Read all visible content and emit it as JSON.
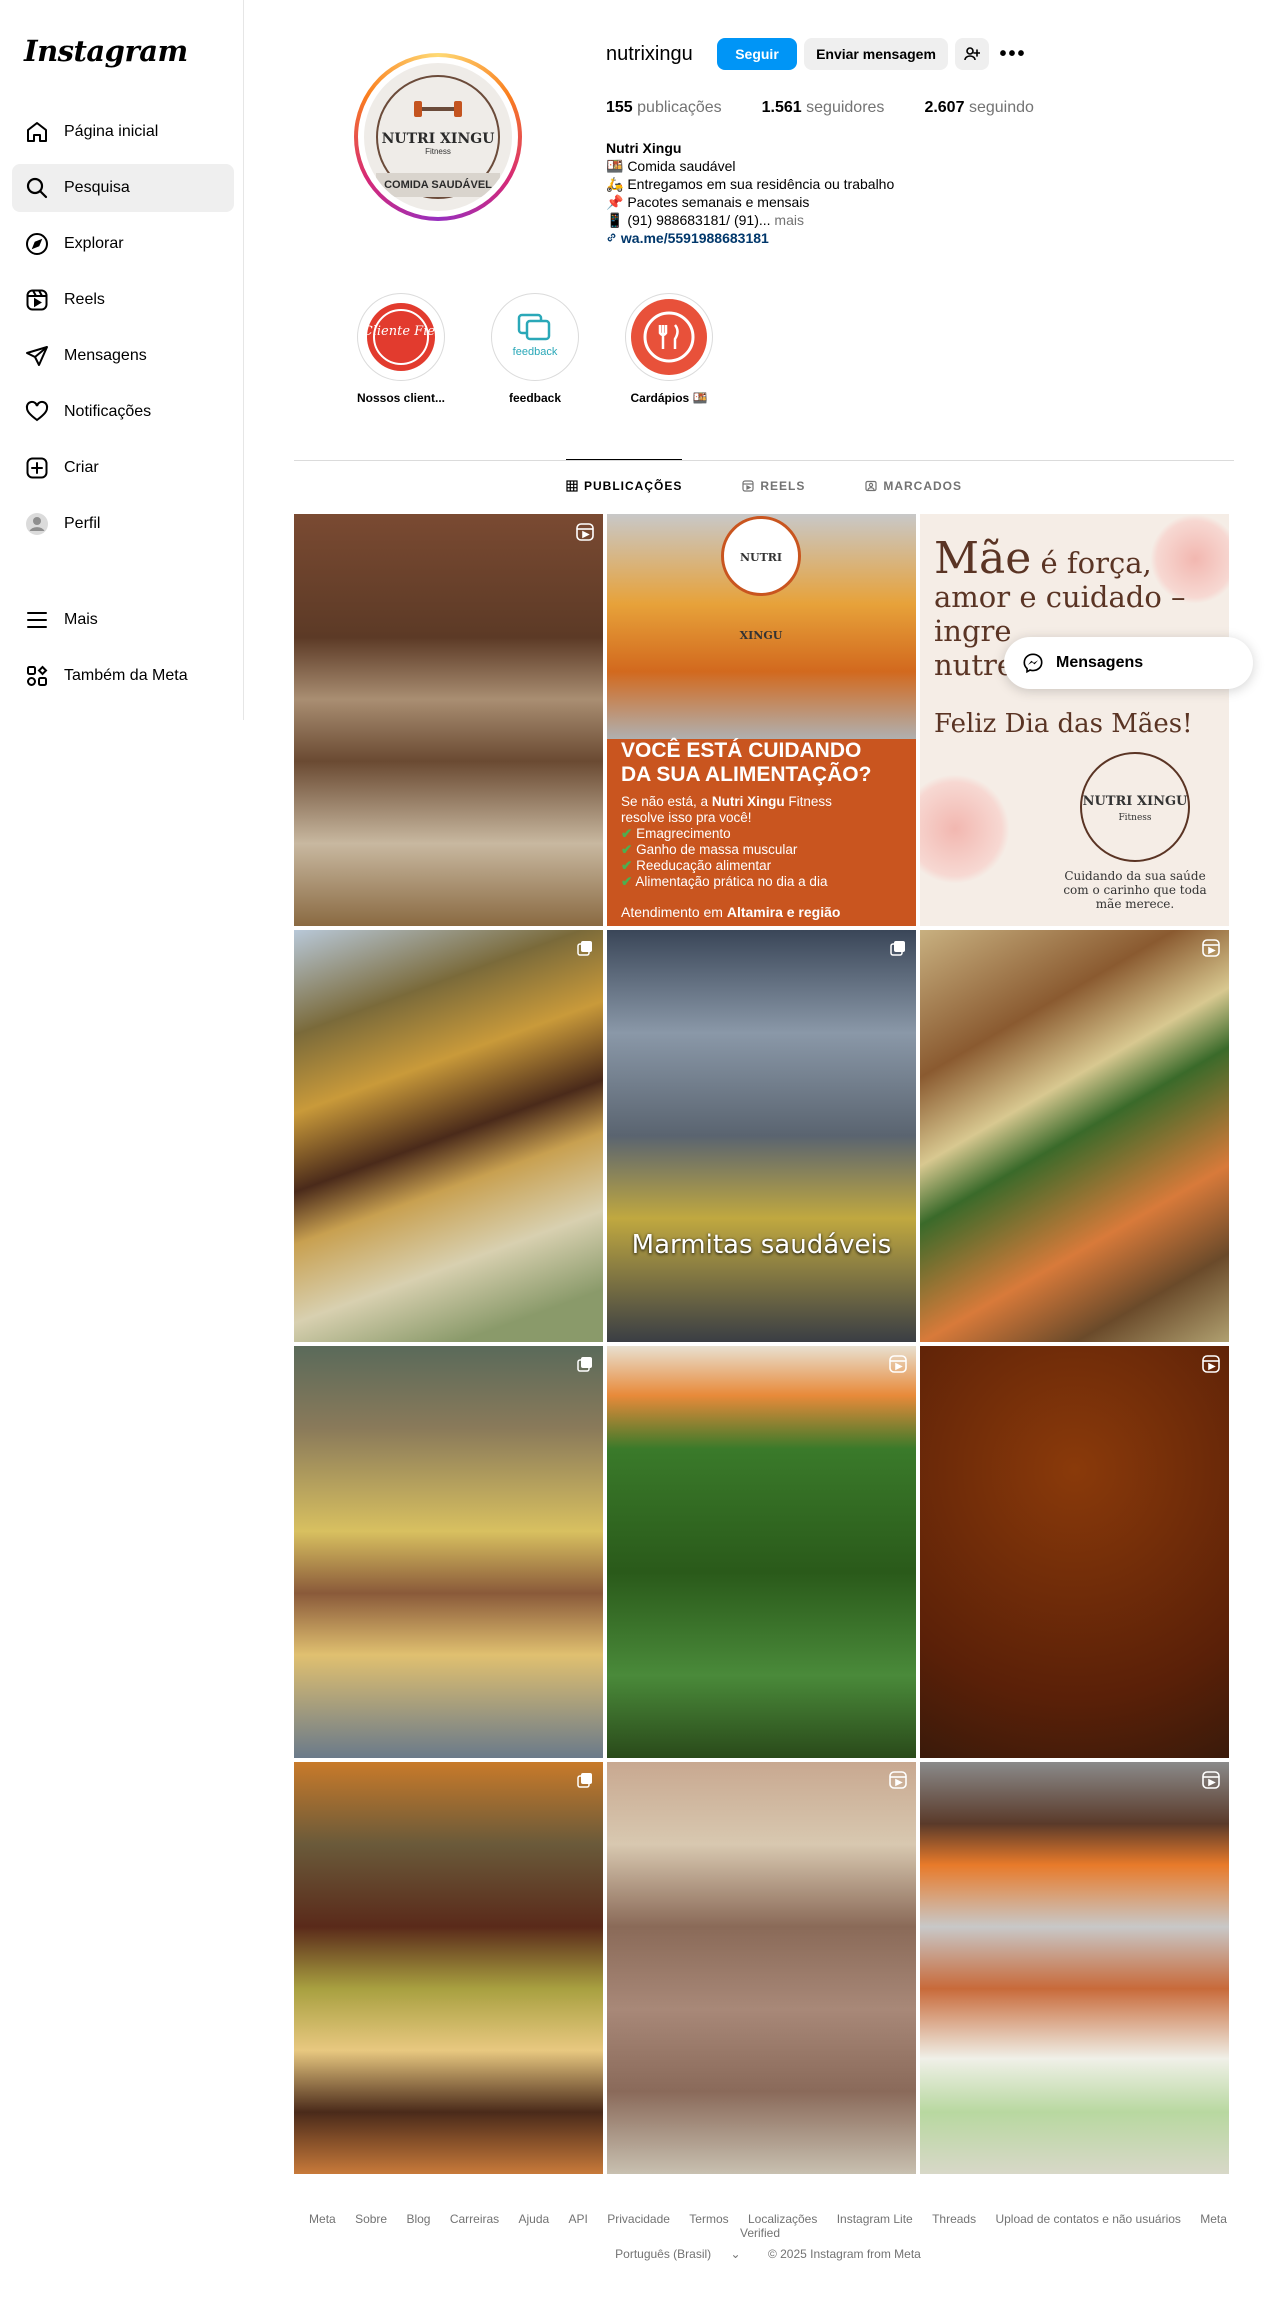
{
  "app": {
    "logo": "Instagram"
  },
  "sidebar": {
    "items": [
      {
        "label": "Página inicial",
        "icon": "home-icon"
      },
      {
        "label": "Pesquisa",
        "icon": "search-icon"
      },
      {
        "label": "Explorar",
        "icon": "compass-icon"
      },
      {
        "label": "Reels",
        "icon": "reels-icon"
      },
      {
        "label": "Mensagens",
        "icon": "send-icon"
      },
      {
        "label": "Notificações",
        "icon": "heart-icon"
      },
      {
        "label": "Criar",
        "icon": "plus-square-icon"
      },
      {
        "label": "Perfil",
        "icon": "avatar-icon"
      }
    ],
    "bottom": [
      {
        "label": "Mais",
        "icon": "menu-icon"
      },
      {
        "label": "Também da Meta",
        "icon": "meta-apps-icon"
      }
    ]
  },
  "profile": {
    "avatar": {
      "name": "NUTRI XINGU",
      "sub": "Fitness",
      "band": "COMIDA SAUDÁVEL"
    },
    "username": "nutrixingu",
    "follow_label": "Seguir",
    "message_label": "Enviar mensagem",
    "stats": {
      "posts_count": "155",
      "posts_label": "publicações",
      "followers_count": "1.561",
      "followers_label": "seguidores",
      "following_count": "2.607",
      "following_label": "seguindo"
    },
    "bio": {
      "name": "Nutri Xingu",
      "lines": [
        "🍱 Comida saudável",
        "🛵 Entregamos em sua residência ou trabalho",
        "📌 Pacotes semanais e mensais",
        "📱 (91) 988683181/ (91)..."
      ],
      "more": "mais",
      "link": "wa.me/5591988683181"
    }
  },
  "highlights": [
    {
      "label": "Nossos client...",
      "art": "Cliente Fiel"
    },
    {
      "label": "feedback",
      "art": "feedback"
    },
    {
      "label": "Cardápios 🍱",
      "art": ""
    }
  ],
  "tabs": [
    {
      "label": "PUBLICAÇÕES",
      "active": true
    },
    {
      "label": "REELS",
      "active": false
    },
    {
      "label": "MARCADOS",
      "active": false
    }
  ],
  "posts": {
    "p2": {
      "logo": "NUTRI XINGU",
      "title1": "VOCÊ ESTÁ CUIDANDO",
      "title2": "DA SUA ALIMENTAÇÃO?",
      "intro_a": "Se não está, a ",
      "intro_b": "Nutri Xingu",
      "intro_c": " Fitness",
      "intro_d": "resolve isso pra você!",
      "items": [
        "Emagrecimento",
        "Ganho de massa muscular",
        "Reeducação alimentar",
        "Alimentação prática no dia a dia"
      ],
      "foot_a": "Atendimento em ",
      "foot_b": "Altamira e região"
    },
    "p3": {
      "mae": "Mãe",
      "line1_rest": " é força,",
      "line2": "amor e cuidado –",
      "line3": "ingre",
      "line4": "nutrem a vida.",
      "feliz": "Feliz Dia das Mães!",
      "logo": "NUTRI XINGU",
      "logo_sub": "Fitness",
      "small": "Cuidando da sua saúde com o carinho que toda mãe merece."
    },
    "p5": {
      "caption": "Marmitas saudáveis"
    }
  },
  "messages_pill": {
    "label": "Mensagens"
  },
  "footer": {
    "links": [
      "Meta",
      "Sobre",
      "Blog",
      "Carreiras",
      "Ajuda",
      "API",
      "Privacidade",
      "Termos",
      "Localizações",
      "Instagram Lite",
      "Threads",
      "Upload de contatos e não usuários",
      "Meta Verified"
    ],
    "language": "Português (Brasil)",
    "copyright": "© 2025 Instagram from Meta"
  },
  "colors": {
    "accent": "#0095f6",
    "link": "#00376b",
    "muted": "#737373"
  }
}
